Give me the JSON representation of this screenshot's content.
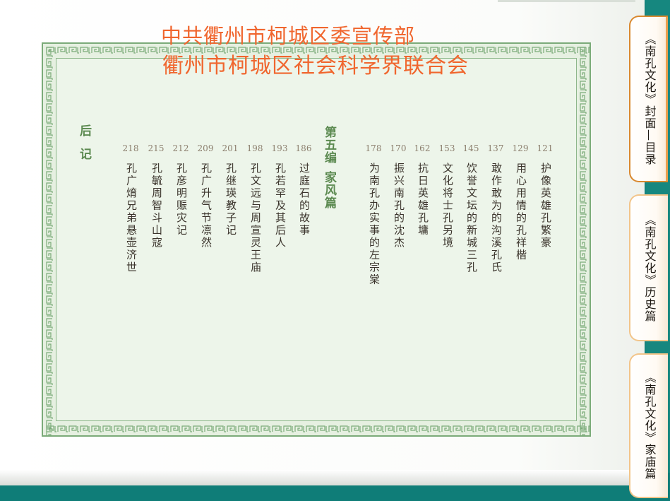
{
  "header": {
    "org_line1": "中共衢州市柯城区委宣传部",
    "org_line2": "衢州市柯城区社会科学界联合会"
  },
  "toc": {
    "group1": [
      {
        "page": "121",
        "title": "护像英雄孔繁豪"
      },
      {
        "page": "129",
        "title": "用心用情的孔祥楷"
      },
      {
        "page": "137",
        "title": "敢作敢为的沟溪孔氏"
      },
      {
        "page": "145",
        "title": "饮誉文坛的新城三孔"
      },
      {
        "page": "153",
        "title": "文化将士孔另境"
      },
      {
        "page": "162",
        "title": "抗日英雄孔墉"
      },
      {
        "page": "170",
        "title": "振兴南孔的沈杰"
      },
      {
        "page": "178",
        "title": "为南孔办实事的左宗棠"
      }
    ],
    "section_title_a": "第五编",
    "section_title_b": "家风篇",
    "group2": [
      {
        "page": "186",
        "title": "过庭石的故事"
      },
      {
        "page": "193",
        "title": "孔若罕及其后人"
      },
      {
        "page": "198",
        "title": "孔文远与周宣灵王庙"
      },
      {
        "page": "201",
        "title": "孔继瑛教子记"
      },
      {
        "page": "209",
        "title": "孔广升气节凛然"
      },
      {
        "page": "212",
        "title": "孔彦明赈灾记"
      },
      {
        "page": "215",
        "title": "孔毓周智斗山寇"
      },
      {
        "page": "218",
        "title": "孔广焴兄弟悬壶济世"
      }
    ],
    "afterword": "后记"
  },
  "tabs": [
    {
      "label": "《南孔文化》封面—目录",
      "active": true
    },
    {
      "label": "《南孔文化》历史篇",
      "active": false
    },
    {
      "label": "《南孔文化》家庙篇",
      "active": false
    }
  ],
  "colors": {
    "background_teal": "#16877f",
    "frame_green": "#7bab79",
    "org_orange": "#f0662e",
    "section_green": "#5c8a51",
    "tab_active_border": "#d9892f"
  }
}
